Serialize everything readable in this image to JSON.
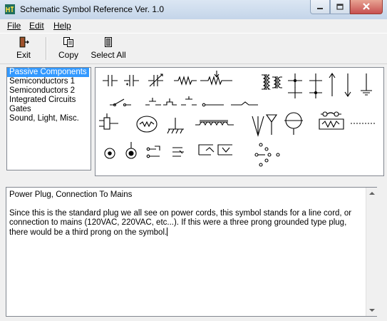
{
  "window": {
    "title": "Schematic Symbol Reference Ver. 1.0"
  },
  "menu": {
    "file": "File",
    "edit": "Edit",
    "help": "Help"
  },
  "toolbar": {
    "exit": "Exit",
    "copy": "Copy",
    "select_all": "Select All"
  },
  "categories": {
    "items": [
      "Passive Components",
      "Semiconductors 1",
      "Semiconductors 2",
      "Integrated Circuits",
      "Gates",
      "Sound, Light, Misc."
    ],
    "selected": "Passive Components"
  },
  "description": {
    "title": "Power Plug, Connection To Mains",
    "body": "Since this is the standard plug we all see on power cords, this symbol stands for a line cord, or connection to mains (120VAC, 220VAC, etc...). If this were a three prong grounded type plug, there would be a third prong on the symbol."
  }
}
